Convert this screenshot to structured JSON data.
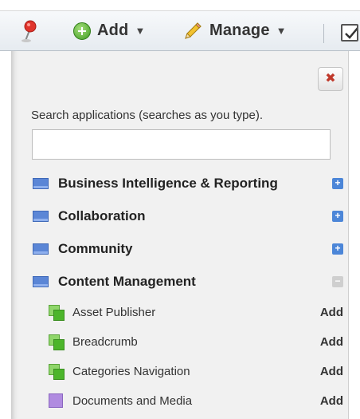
{
  "toolbar": {
    "add_label": "Add",
    "manage_label": "Manage",
    "caret": "▼",
    "icons": [
      "pin-icon",
      "add-circle-icon",
      "pencil-icon",
      "checkbox-icon"
    ]
  },
  "panel": {
    "close_glyph": "✖",
    "search_hint": "Search applications (searches as you type).",
    "search_value": "",
    "expand_glyph": "+",
    "collapse_glyph": "−",
    "categories": [
      {
        "label": "Business Intelligence & Reporting",
        "state": "collapsed"
      },
      {
        "label": "Collaboration",
        "state": "collapsed"
      },
      {
        "label": "Community",
        "state": "collapsed"
      },
      {
        "label": "Content Management",
        "state": "expanded"
      }
    ],
    "apps": [
      {
        "label": "Asset Publisher",
        "action": "Add"
      },
      {
        "label": "Breadcrumb",
        "action": "Add"
      },
      {
        "label": "Categories Navigation",
        "action": "Add"
      },
      {
        "label": "Documents and Media",
        "action": "Add"
      }
    ]
  },
  "colors": {
    "category_icon": "#5b86d6",
    "app_icon_green": "#4cb52b",
    "app_icon_purple": "#b08be0",
    "close_red": "#c0392b"
  }
}
